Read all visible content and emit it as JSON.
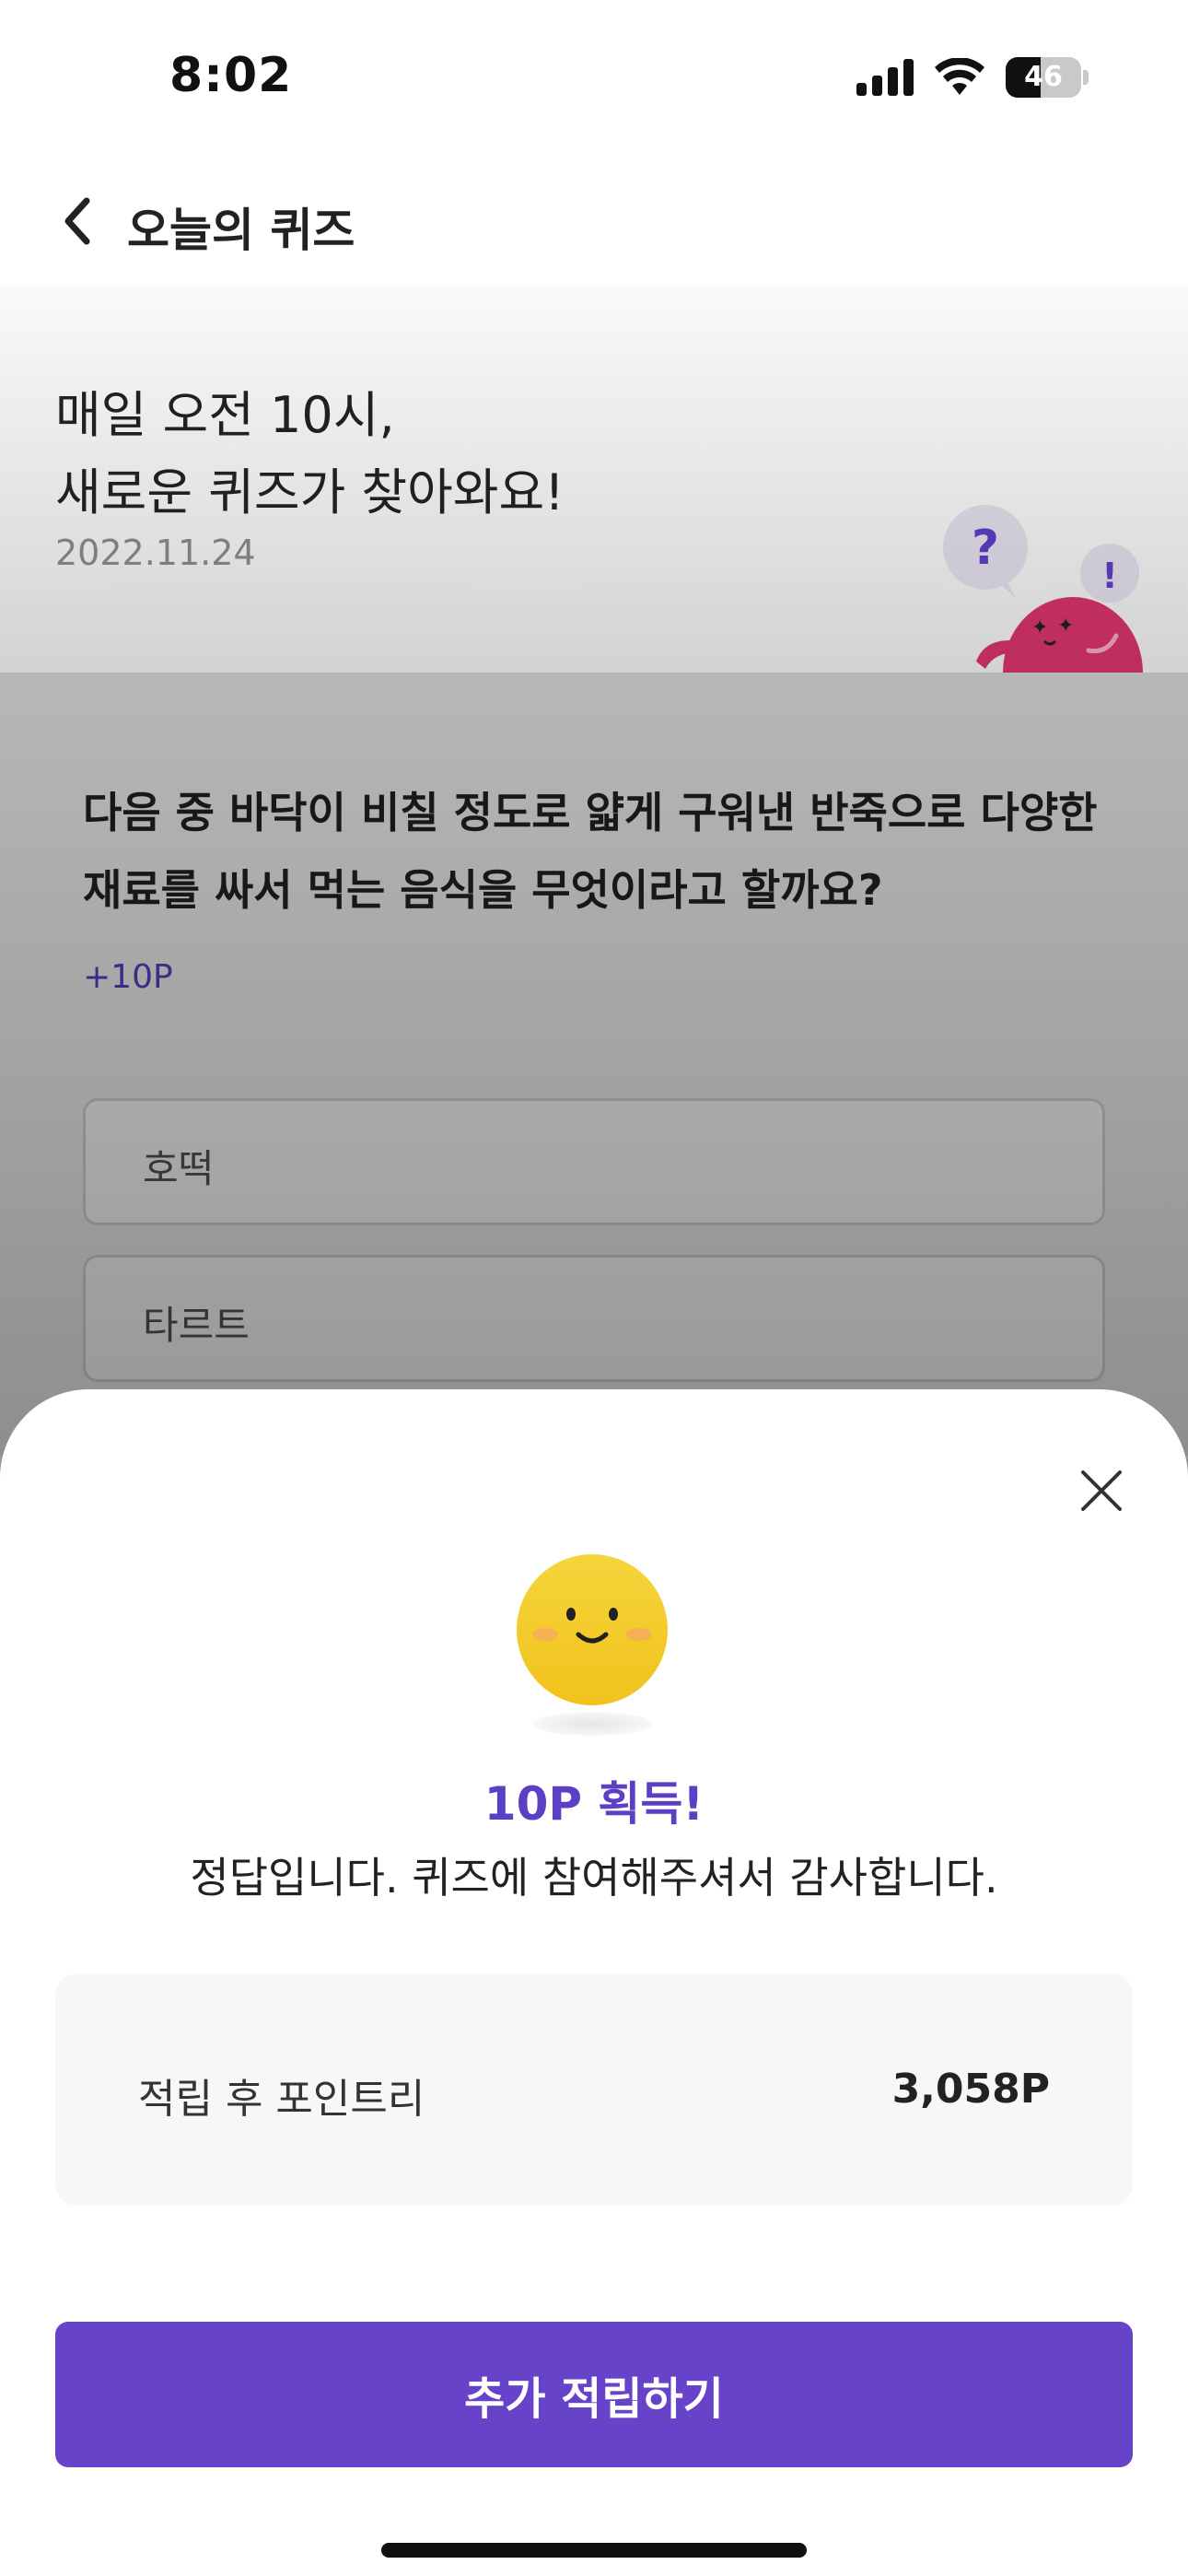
{
  "status_bar": {
    "time": "8:02",
    "battery": "46",
    "battery_level": 0.46
  },
  "header": {
    "title": "오늘의 퀴즈",
    "back_icon": "chevron-left-icon"
  },
  "hero": {
    "line1": "매일 오전 10시,",
    "line2": "새로운 퀴즈가 찾아와요!",
    "date": "2022.11.24"
  },
  "quiz": {
    "question": "다음 중 바닥이 비칠 정도로 얇게 구워낸 반죽으로 다양한 재료를 싸서 먹는 음식을 무엇이라고 할까요?",
    "reward": "+10P",
    "options": [
      "호떡",
      "타르트"
    ]
  },
  "sheet": {
    "close_icon": "close-icon",
    "emoji_icon": "smiley-face-icon",
    "points_earned": "10P 획득!",
    "message": "정답입니다. 퀴즈에 참여해주셔서 감사합니다.",
    "balance_label": "적립 후 포인트리",
    "balance_value": "3,058P",
    "cta_label": "추가 적립하기"
  },
  "colors": {
    "accent": "#6643c8",
    "accent_text": "#5b3fc4",
    "mascot": "#d6336c"
  }
}
